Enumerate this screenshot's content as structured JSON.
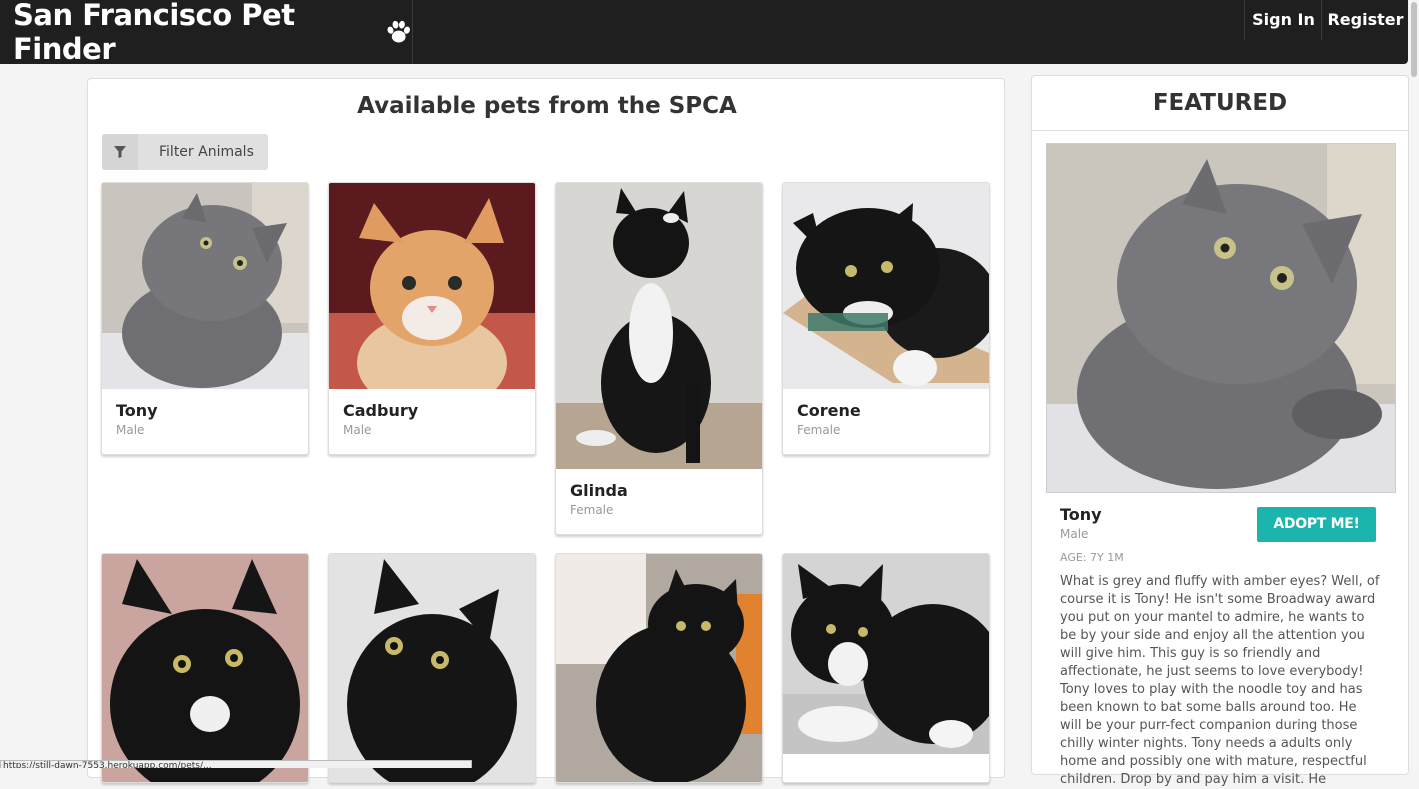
{
  "nav": {
    "brand": "San Francisco Pet Finder",
    "signin": "Sign In",
    "register": "Register"
  },
  "main": {
    "title": "Available pets from the SPCA",
    "filter_label": "Filter Animals",
    "pets": [
      {
        "name": "Tony",
        "sex": "Male"
      },
      {
        "name": "Cadbury",
        "sex": "Male"
      },
      {
        "name": "Glinda",
        "sex": "Female"
      },
      {
        "name": "Corene",
        "sex": "Female"
      }
    ]
  },
  "featured": {
    "header": "FEATURED",
    "name": "Tony",
    "sex": "Male",
    "adopt_label": "ADOPT ME!",
    "age": "AGE: 7Y 1M",
    "description": "What is grey and fluffy with amber eyes? Well, of course it is Tony! He isn't some Broadway award you put on your mantel to admire, he wants to be by your side and enjoy all the attention you will give him. This guy is so friendly and affectionate, he just seems to love everybody! Tony loves to play with the noodle toy and has been known to bat some balls around too. He will be your purr-fect companion during those chilly winter nights. Tony needs a adults only home and possibly one with mature, respectful children. Drop by and pay him a visit. He"
  },
  "status_url": "https://still-dawn-7553.herokuapp.com/pets/...",
  "colors": {
    "navbar": "#1f1f1f",
    "accent": "#1bb5ad"
  }
}
